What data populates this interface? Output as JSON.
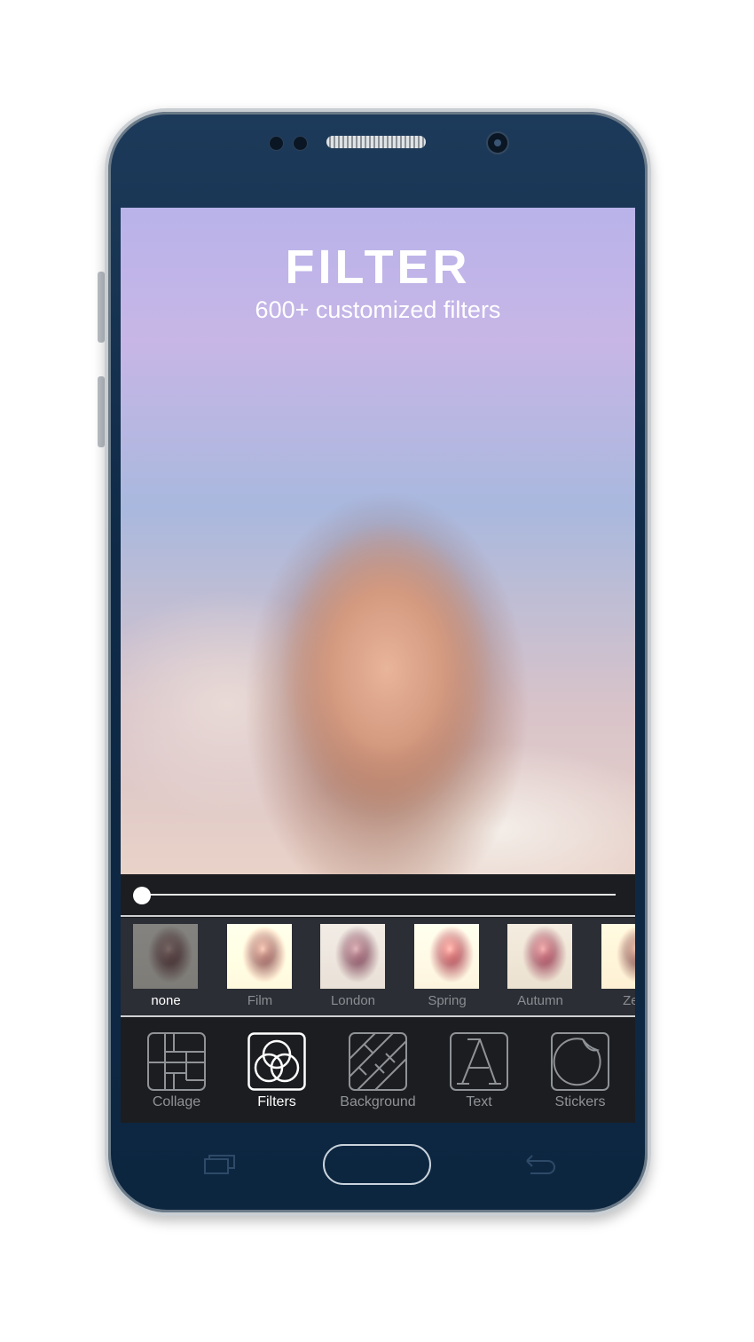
{
  "promo": {
    "title": "FILTER",
    "subtitle": "600+ customized filters"
  },
  "slider": {
    "value": 0
  },
  "filters": [
    {
      "label": "none",
      "selected": true
    },
    {
      "label": "Film",
      "selected": false
    },
    {
      "label": "London",
      "selected": false
    },
    {
      "label": "Spring",
      "selected": false
    },
    {
      "label": "Autumn",
      "selected": false
    },
    {
      "label": "Zep",
      "selected": false
    }
  ],
  "toolbar": [
    {
      "label": "Collage",
      "icon": "collage-icon",
      "selected": false
    },
    {
      "label": "Filters",
      "icon": "filters-icon",
      "selected": true
    },
    {
      "label": "Background",
      "icon": "background-icon",
      "selected": false
    },
    {
      "label": "Text",
      "icon": "text-icon",
      "selected": false
    },
    {
      "label": "Stickers",
      "icon": "stickers-icon",
      "selected": false
    }
  ],
  "colors": {
    "phone": "#0f2a47",
    "panel": "#1c1d20",
    "strip": "#2b2e34",
    "active": "#ffffff",
    "inactive": "#8f9296"
  }
}
